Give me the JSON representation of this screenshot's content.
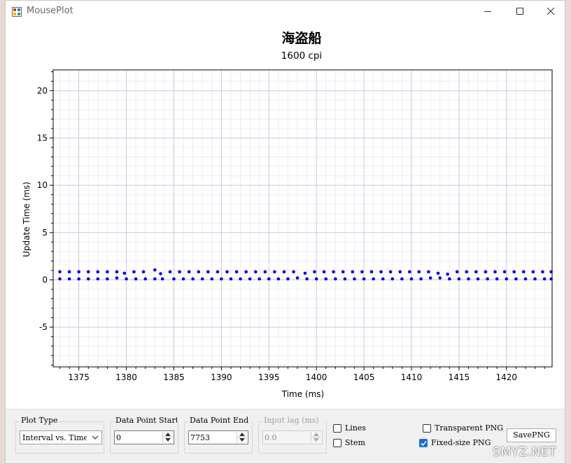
{
  "window": {
    "title": "MousePlot",
    "controls": [
      "minimize-icon",
      "maximize-icon",
      "close-icon"
    ]
  },
  "chart_data": {
    "type": "scatter",
    "title": "海盗船",
    "subtitle": "1600 cpi",
    "xlabel": "Time (ms)",
    "ylabel": "Update Time (ms)",
    "xlim": [
      1372.3,
      1424.8
    ],
    "ylim": [
      -9.2,
      22.2
    ],
    "xticks": [
      1375,
      1380,
      1385,
      1390,
      1395,
      1400,
      1405,
      1410,
      1415,
      1420
    ],
    "yticks": [
      -5,
      0,
      5,
      10,
      15,
      20
    ],
    "grid": true,
    "marker_color": "#0000ee",
    "series": [
      {
        "points": [
          [
            1373.0,
            0.85
          ],
          [
            1373.0,
            0.1
          ],
          [
            1374.0,
            0.85
          ],
          [
            1374.0,
            0.1
          ],
          [
            1375.0,
            0.85
          ],
          [
            1375.0,
            0.1
          ],
          [
            1376.0,
            0.85
          ],
          [
            1376.0,
            0.1
          ],
          [
            1377.0,
            0.85
          ],
          [
            1377.0,
            0.1
          ],
          [
            1378.0,
            0.85
          ],
          [
            1378.0,
            0.1
          ],
          [
            1379.0,
            0.85
          ],
          [
            1379.0,
            0.2
          ],
          [
            1379.8,
            0.7
          ],
          [
            1380.0,
            0.1
          ],
          [
            1380.8,
            0.85
          ],
          [
            1381.0,
            0.1
          ],
          [
            1381.8,
            0.85
          ],
          [
            1382.0,
            0.1
          ],
          [
            1383.0,
            1.05
          ],
          [
            1383.0,
            0.1
          ],
          [
            1383.6,
            0.65
          ],
          [
            1383.8,
            0.1
          ],
          [
            1384.6,
            0.85
          ],
          [
            1385.0,
            0.1
          ],
          [
            1385.6,
            0.85
          ],
          [
            1386.0,
            0.1
          ],
          [
            1386.6,
            0.85
          ],
          [
            1387.0,
            0.1
          ],
          [
            1387.6,
            0.85
          ],
          [
            1388.0,
            0.1
          ],
          [
            1388.6,
            0.85
          ],
          [
            1389.0,
            0.1
          ],
          [
            1389.6,
            0.85
          ],
          [
            1390.0,
            0.1
          ],
          [
            1390.6,
            0.85
          ],
          [
            1391.0,
            0.1
          ],
          [
            1391.6,
            0.85
          ],
          [
            1392.0,
            0.1
          ],
          [
            1392.6,
            0.85
          ],
          [
            1393.0,
            0.1
          ],
          [
            1393.6,
            0.85
          ],
          [
            1394.0,
            0.1
          ],
          [
            1394.6,
            0.85
          ],
          [
            1395.0,
            0.1
          ],
          [
            1395.6,
            0.85
          ],
          [
            1396.0,
            0.1
          ],
          [
            1396.6,
            0.85
          ],
          [
            1397.0,
            0.1
          ],
          [
            1397.6,
            0.85
          ],
          [
            1398.0,
            0.2
          ],
          [
            1398.8,
            0.7
          ],
          [
            1399.0,
            0.1
          ],
          [
            1399.8,
            0.85
          ],
          [
            1400.0,
            0.1
          ],
          [
            1400.8,
            0.85
          ],
          [
            1401.0,
            0.1
          ],
          [
            1401.8,
            0.85
          ],
          [
            1402.0,
            0.1
          ],
          [
            1402.8,
            0.85
          ],
          [
            1403.0,
            0.1
          ],
          [
            1403.8,
            0.85
          ],
          [
            1404.0,
            0.1
          ],
          [
            1404.8,
            0.85
          ],
          [
            1405.0,
            0.1
          ],
          [
            1405.8,
            0.85
          ],
          [
            1406.0,
            0.1
          ],
          [
            1406.8,
            0.85
          ],
          [
            1407.0,
            0.1
          ],
          [
            1407.8,
            0.85
          ],
          [
            1408.0,
            0.1
          ],
          [
            1408.8,
            0.85
          ],
          [
            1409.0,
            0.1
          ],
          [
            1409.8,
            0.85
          ],
          [
            1410.0,
            0.1
          ],
          [
            1410.8,
            0.85
          ],
          [
            1411.0,
            0.1
          ],
          [
            1411.8,
            0.85
          ],
          [
            1412.0,
            0.2
          ],
          [
            1412.8,
            0.7
          ],
          [
            1413.0,
            0.2
          ],
          [
            1413.8,
            0.6
          ],
          [
            1414.0,
            0.1
          ],
          [
            1414.8,
            0.85
          ],
          [
            1415.0,
            0.1
          ],
          [
            1415.8,
            0.85
          ],
          [
            1416.0,
            0.1
          ],
          [
            1416.8,
            0.85
          ],
          [
            1417.0,
            0.1
          ],
          [
            1417.8,
            0.85
          ],
          [
            1418.0,
            0.1
          ],
          [
            1418.8,
            0.85
          ],
          [
            1419.0,
            0.1
          ],
          [
            1419.8,
            0.85
          ],
          [
            1420.0,
            0.1
          ],
          [
            1420.8,
            0.85
          ],
          [
            1421.0,
            0.1
          ],
          [
            1421.8,
            0.85
          ],
          [
            1422.0,
            0.1
          ],
          [
            1422.8,
            0.85
          ],
          [
            1423.0,
            0.1
          ],
          [
            1423.8,
            0.85
          ],
          [
            1424.0,
            0.1
          ],
          [
            1424.7,
            0.85
          ],
          [
            1424.7,
            0.1
          ]
        ]
      }
    ]
  },
  "controls": {
    "plot_type": {
      "label": "Plot Type",
      "value": "Interval vs. Time"
    },
    "data_point_start": {
      "label": "Data Point Start",
      "value": "0"
    },
    "data_point_end": {
      "label": "Data Point End",
      "value": "7753"
    },
    "input_lag": {
      "label": "Input lag (ms)",
      "value": "0.0"
    },
    "lines": {
      "label": "Lines",
      "checked": false
    },
    "stem": {
      "label": "Stem",
      "checked": false
    },
    "transparent_png": {
      "label": "Transparent PNG",
      "checked": false
    },
    "fixed_size_png": {
      "label": "Fixed-size PNG",
      "checked": true
    },
    "save_png": {
      "label": "SavePNG"
    }
  },
  "watermark": "SMYZ.NET"
}
